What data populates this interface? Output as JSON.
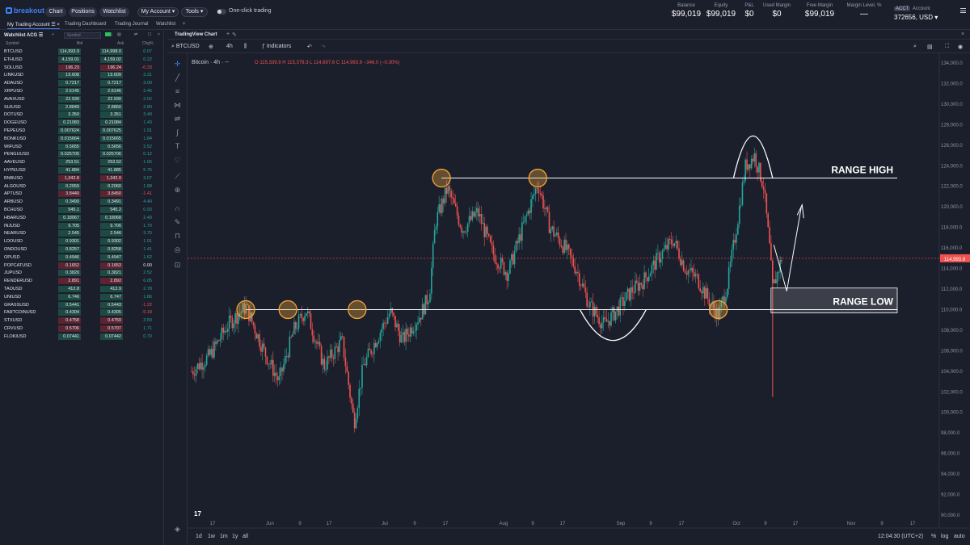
{
  "topbar": {
    "logo": "breakout",
    "nav": [
      "Chart",
      "Positions",
      "Watchlist"
    ],
    "account_menu": "My Account",
    "tools_menu": "Tools",
    "one_click": "One-click trading",
    "stats": [
      {
        "label": "Balance",
        "value": "$99,019"
      },
      {
        "label": "Equity",
        "value": "$99,019"
      },
      {
        "label": "P&L",
        "value": "$0"
      },
      {
        "label": "Used Margin",
        "value": "$0"
      },
      {
        "label": "Free Margin",
        "value": "$99,019"
      },
      {
        "label": "Margin Level, %",
        "value": "—"
      }
    ],
    "account": {
      "tag": "ACCT",
      "label": "Account",
      "value": "372656, USD"
    }
  },
  "tabs": [
    "My Trading Account",
    "Trading Dashboard",
    "Trading Journal",
    "Watchlist"
  ],
  "watchlist": {
    "title": "Watchlist ACG",
    "symbol_placeholder": "Symbol",
    "columns": [
      "Symbol",
      "Bid",
      "Ask",
      "Chg%"
    ],
    "rows": [
      {
        "s": "BTCUSD",
        "b": "114,993.9",
        "a": "114,998.0",
        "c": "0.07",
        "dir": "up"
      },
      {
        "s": "ETHUSD",
        "b": "4,159.01",
        "a": "4,159.02",
        "c": "0.22",
        "dir": "up"
      },
      {
        "s": "SOLUSD",
        "b": "196.23",
        "a": "196.24",
        "c": "-0.33",
        "dir": "down"
      },
      {
        "s": "LINKUSD",
        "b": "19.608",
        "a": "19.609",
        "c": "3.31",
        "dir": "up"
      },
      {
        "s": "ADAUSD",
        "b": "0.7217",
        "a": "0.7217",
        "c": "3.09",
        "dir": "up"
      },
      {
        "s": "XRPUSD",
        "b": "2.6145",
        "a": "2.6146",
        "c": "3.46",
        "dir": "up"
      },
      {
        "s": "AVAXUSD",
        "b": "22.939",
        "a": "22.939",
        "c": "2.02",
        "dir": "up"
      },
      {
        "s": "SUIUSD",
        "b": "2.8849",
        "a": "2.8850",
        "c": "2.80",
        "dir": "up"
      },
      {
        "s": "DOTUSD",
        "b": "3.350",
        "a": "3.351",
        "c": "3.49",
        "dir": "up"
      },
      {
        "s": "DOGEUSD",
        "b": "0.21083",
        "a": "0.21084",
        "c": "1.43",
        "dir": "up"
      },
      {
        "s": "PEPEUSD",
        "b": "0.007624",
        "a": "0.007625",
        "c": "1.91",
        "dir": "up"
      },
      {
        "s": "BONKUSD",
        "b": "0.015664",
        "a": "0.015665",
        "c": "1.84",
        "dir": "up"
      },
      {
        "s": "WIFUSD",
        "b": "0.5655",
        "a": "0.5656",
        "c": "2.52",
        "dir": "up"
      },
      {
        "s": "PENGUUSD",
        "b": "0.025705",
        "a": "0.025706",
        "c": "0.12",
        "dir": "up"
      },
      {
        "s": "AAVEUSD",
        "b": "253.51",
        "a": "253.52",
        "c": "1.06",
        "dir": "up"
      },
      {
        "s": "HYPEUSD",
        "b": "41.884",
        "a": "41.885",
        "c": "5.75",
        "dir": "up"
      },
      {
        "s": "BNBUSD",
        "b": "1,342.8",
        "a": "1,342.9",
        "c": "3.07",
        "dir": "down"
      },
      {
        "s": "ALGOUSD",
        "b": "0.2059",
        "a": "0.2060",
        "c": "1.88",
        "dir": "up"
      },
      {
        "s": "APTUSD",
        "b": "3.8440",
        "a": "3.8450",
        "c": "-1.41",
        "dir": "down"
      },
      {
        "s": "ARBUSD",
        "b": "0.3490",
        "a": "0.3491",
        "c": "4.40",
        "dir": "up"
      },
      {
        "s": "BCHUSD",
        "b": "545.1",
        "a": "545.2",
        "c": "0.93",
        "dir": "up"
      },
      {
        "s": "HBARUSD",
        "b": "0.18067",
        "a": "0.18068",
        "c": "2.49",
        "dir": "up"
      },
      {
        "s": "INJUSD",
        "b": "9.705",
        "a": "9.706",
        "c": "1.70",
        "dir": "up"
      },
      {
        "s": "NEARUSD",
        "b": "2.545",
        "a": "2.546",
        "c": "3.75",
        "dir": "up"
      },
      {
        "s": "LDOUSD",
        "b": "0.9301",
        "a": "0.9302",
        "c": "1.91",
        "dir": "up"
      },
      {
        "s": "ONDOUSD",
        "b": "0.8257",
        "a": "0.8258",
        "c": "1.41",
        "dir": "up"
      },
      {
        "s": "OPUSD",
        "b": "0.4946",
        "a": "0.4947",
        "c": "1.62",
        "dir": "up"
      },
      {
        "s": "POPCATUSD",
        "b": "0.1652",
        "a": "0.1653",
        "c": "0.00",
        "dir": "down"
      },
      {
        "s": "JUPUSD",
        "b": "0.3820",
        "a": "0.3821",
        "c": "2.52",
        "dir": "up"
      },
      {
        "s": "RENDERUSD",
        "b": "2.891",
        "a": "2.892",
        "c": "6.05",
        "dir": "down"
      },
      {
        "s": "TAOUSD",
        "b": "412.8",
        "a": "412.9",
        "c": "2.78",
        "dir": "up"
      },
      {
        "s": "UNIUSD",
        "b": "6.746",
        "a": "6.747",
        "c": "1.86",
        "dir": "up"
      },
      {
        "s": "GRASSUSD",
        "b": "0.5441",
        "a": "0.5443",
        "c": "-1.22",
        "dir": "up"
      },
      {
        "s": "FARTCOINUSD",
        "b": "0.4304",
        "a": "0.4305",
        "c": "-5.18",
        "dir": "up"
      },
      {
        "s": "STXUSD",
        "b": "0.4758",
        "a": "0.4759",
        "c": "3.50",
        "dir": "down"
      },
      {
        "s": "CRVUSD",
        "b": "0.5706",
        "a": "0.5707",
        "c": "1.71",
        "dir": "down"
      },
      {
        "s": "FLOKIUSD",
        "b": "0.07441",
        "a": "0.07442",
        "c": "0.70",
        "dir": "up"
      }
    ]
  },
  "chart_panel": {
    "title": "TradingView Chart",
    "symbol": "BTCUSD",
    "interval": "4h",
    "indicators": "Indicators",
    "legend_title": "Bitcoin · 4h · --",
    "ohlc": "O 115,339.9  H 115,379.3  L 114,697.6  C 114,993.9  −346.0 (−0.30%)",
    "price_tag": "114,993.9",
    "time": "12:04:30 (UTC+2)",
    "ranges": [
      "1d",
      "1w",
      "1m",
      "1y",
      "all"
    ],
    "scale_opts": [
      "%",
      "log",
      "auto"
    ],
    "range_high": "RANGE HIGH",
    "range_low": "RANGE LOW",
    "colors": {
      "up": "#26a69a",
      "down": "#ef5350",
      "bg": "#1b1e2b",
      "marker": "#f0a53a"
    }
  },
  "chart_data": {
    "type": "candlestick",
    "title": "Bitcoin · 4h",
    "y_ticks": [
      90000,
      92000,
      94000,
      96000,
      98000,
      100000,
      102000,
      104000,
      106000,
      108000,
      110000,
      112000,
      114000,
      116000,
      118000,
      120000,
      122000,
      124000,
      126000,
      128000,
      130000,
      132000,
      134000
    ],
    "ylim": [
      89500,
      135000
    ],
    "x_ticks": [
      "17",
      "Jun",
      "9",
      "17",
      "Jul",
      "9",
      "17",
      "Aug",
      "9",
      "17",
      "Sep",
      "9",
      "17",
      "Oct",
      "9",
      "17",
      "Nov",
      "9",
      "17"
    ],
    "anchors": [
      {
        "t": 0,
        "p": 104000
      },
      {
        "t": 6,
        "p": 105500
      },
      {
        "t": 12,
        "p": 108500
      },
      {
        "t": 18,
        "p": 110300
      },
      {
        "t": 24,
        "p": 106000
      },
      {
        "t": 29,
        "p": 103000
      },
      {
        "t": 34,
        "p": 108000
      },
      {
        "t": 38,
        "p": 110000
      },
      {
        "t": 44,
        "p": 104500
      },
      {
        "t": 50,
        "p": 107000
      },
      {
        "t": 54,
        "p": 99000
      },
      {
        "t": 57,
        "p": 104500
      },
      {
        "t": 62,
        "p": 107500
      },
      {
        "t": 66,
        "p": 109800
      },
      {
        "t": 70,
        "p": 107000
      },
      {
        "t": 76,
        "p": 109500
      },
      {
        "t": 79,
        "p": 111500
      },
      {
        "t": 81,
        "p": 118500
      },
      {
        "t": 85,
        "p": 121800
      },
      {
        "t": 90,
        "p": 117800
      },
      {
        "t": 95,
        "p": 119500
      },
      {
        "t": 100,
        "p": 115500
      },
      {
        "t": 105,
        "p": 113500
      },
      {
        "t": 110,
        "p": 118000
      },
      {
        "t": 115,
        "p": 122300
      },
      {
        "t": 119,
        "p": 118000
      },
      {
        "t": 124,
        "p": 116000
      },
      {
        "t": 128,
        "p": 113800
      },
      {
        "t": 132,
        "p": 110500
      },
      {
        "t": 137,
        "p": 108500
      },
      {
        "t": 142,
        "p": 110200
      },
      {
        "t": 146,
        "p": 111800
      },
      {
        "t": 150,
        "p": 112800
      },
      {
        "t": 155,
        "p": 115000
      },
      {
        "t": 160,
        "p": 116800
      },
      {
        "t": 164,
        "p": 114000
      },
      {
        "t": 168,
        "p": 113000
      },
      {
        "t": 172,
        "p": 110800
      },
      {
        "t": 175,
        "p": 109400
      },
      {
        "t": 178,
        "p": 112500
      },
      {
        "t": 181,
        "p": 118000
      },
      {
        "t": 184,
        "p": 124000
      },
      {
        "t": 187,
        "p": 125000
      },
      {
        "t": 190,
        "p": 122000
      },
      {
        "t": 192,
        "p": 116000
      },
      {
        "t": 193,
        "p": 112000
      },
      {
        "t": 195,
        "p": 114000
      },
      {
        "t": 196,
        "p": 115000
      }
    ],
    "levels": {
      "range_high": 122800,
      "range_low": 110000
    },
    "markers": [
      {
        "t": 18,
        "p": 110000
      },
      {
        "t": 32,
        "p": 110000
      },
      {
        "t": 55,
        "p": 110000
      },
      {
        "t": 83,
        "p": 122800
      },
      {
        "t": 115,
        "p": 122800
      },
      {
        "t": 175,
        "p": 110000
      }
    ]
  }
}
